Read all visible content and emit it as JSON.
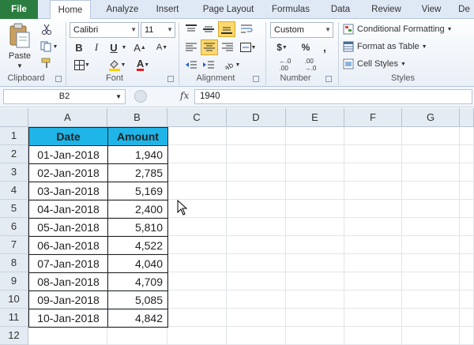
{
  "tabs": [
    "File",
    "Home",
    "Analyze",
    "Insert",
    "Page Layout",
    "Formulas",
    "Data",
    "Review",
    "View",
    "De"
  ],
  "clipboard": {
    "paste_label": "Paste",
    "group_label": "Clipboard"
  },
  "font": {
    "name": "Calibri",
    "size": "11",
    "group_label": "Font",
    "bold": "B",
    "italic": "I",
    "underline": "U"
  },
  "alignment": {
    "group_label": "Alignment"
  },
  "number": {
    "format": "Custom",
    "currency": "$",
    "percent": "%",
    "comma": ",",
    "group_label": "Number"
  },
  "styles": {
    "conditional": "Conditional Formatting",
    "format_table": "Format as Table",
    "cell_styles": "Cell Styles",
    "group_label": "Styles"
  },
  "formula_bar": {
    "name_box": "B2",
    "fx": "fx",
    "value": "1940"
  },
  "columns": [
    "A",
    "B",
    "C",
    "D",
    "E",
    "F",
    "G"
  ],
  "rows": [
    "1",
    "2",
    "3",
    "4",
    "5",
    "6",
    "7",
    "8",
    "9",
    "10",
    "11",
    "12"
  ],
  "table": {
    "headers": [
      "Date",
      "Amount"
    ],
    "rows": [
      [
        "01-Jan-2018",
        "1,940"
      ],
      [
        "02-Jan-2018",
        "2,785"
      ],
      [
        "03-Jan-2018",
        "5,169"
      ],
      [
        "04-Jan-2018",
        "2,400"
      ],
      [
        "05-Jan-2018",
        "5,810"
      ],
      [
        "06-Jan-2018",
        "4,522"
      ],
      [
        "07-Jan-2018",
        "4,040"
      ],
      [
        "08-Jan-2018",
        "4,709"
      ],
      [
        "09-Jan-2018",
        "5,085"
      ],
      [
        "10-Jan-2018",
        "4,842"
      ]
    ]
  },
  "colors": {
    "header_fill": "#1fb5e8",
    "file_tab": "#2a7d3f",
    "active_align": "#fcd86f"
  }
}
